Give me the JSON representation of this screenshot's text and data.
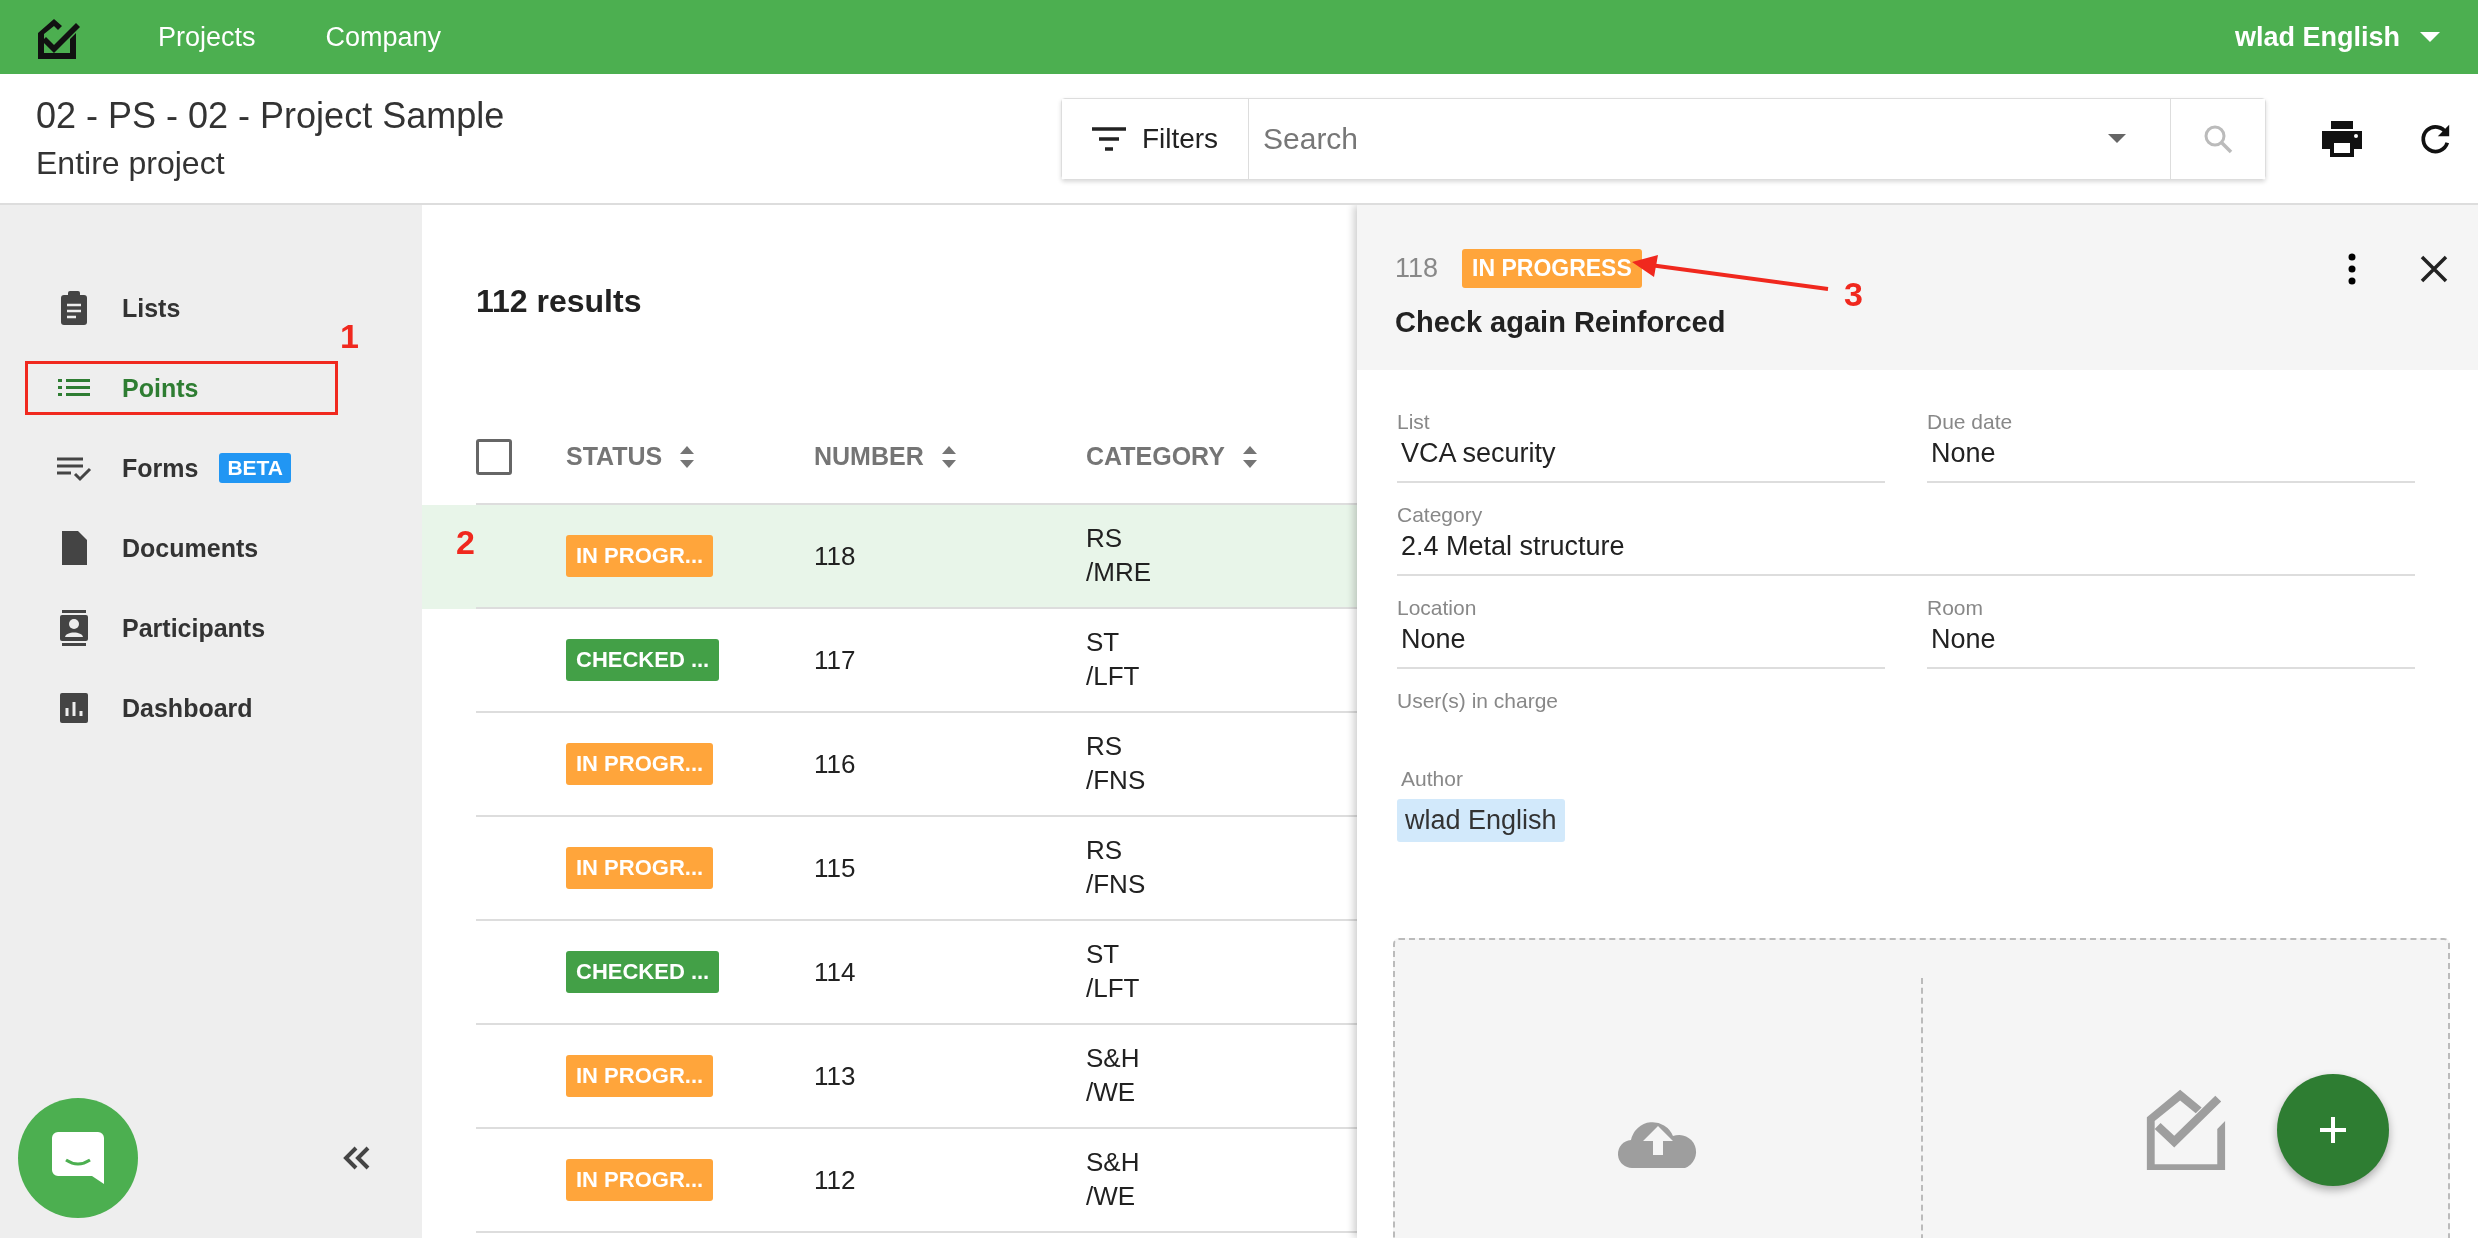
{
  "topbar": {
    "nav": [
      {
        "label": "Projects"
      },
      {
        "label": "Company"
      }
    ],
    "user": "wlad English"
  },
  "header": {
    "title": "02 - PS - 02 - Project Sample",
    "subtitle": "Entire project"
  },
  "search": {
    "filters_label": "Filters",
    "placeholder": "Search"
  },
  "sidebar": {
    "items": [
      {
        "label": "Lists",
        "selected": false,
        "highlighted": false
      },
      {
        "label": "Points",
        "selected": true,
        "highlighted": true
      },
      {
        "label": "Forms",
        "selected": false,
        "highlighted": false,
        "badge": "BETA"
      },
      {
        "label": "Documents",
        "selected": false,
        "highlighted": false
      },
      {
        "label": "Participants",
        "selected": false,
        "highlighted": false
      },
      {
        "label": "Dashboard",
        "selected": false,
        "highlighted": false
      }
    ]
  },
  "results": "112 results",
  "table": {
    "select_all": {
      "checked": false
    },
    "columns": [
      "STATUS",
      "NUMBER",
      "CATEGORY"
    ],
    "rows": [
      {
        "status": "IN PROGR...",
        "kind": "in_progress",
        "number": "118",
        "category": "RS\n/MRE",
        "selected": true
      },
      {
        "status": "CHECKED ...",
        "kind": "checked",
        "number": "117",
        "category": "ST\n/LFT",
        "selected": false
      },
      {
        "status": "IN PROGR...",
        "kind": "in_progress",
        "number": "116",
        "category": "RS\n/FNS",
        "selected": false
      },
      {
        "status": "IN PROGR...",
        "kind": "in_progress",
        "number": "115",
        "category": "RS\n/FNS",
        "selected": false
      },
      {
        "status": "CHECKED ...",
        "kind": "checked",
        "number": "114",
        "category": "ST\n/LFT",
        "selected": false
      },
      {
        "status": "IN PROGR...",
        "kind": "in_progress",
        "number": "113",
        "category": "S&H\n/WE",
        "selected": false
      },
      {
        "status": "IN PROGR...",
        "kind": "in_progress",
        "number": "112",
        "category": "S&H\n/WE",
        "selected": false
      }
    ]
  },
  "panel": {
    "number": "118",
    "status": {
      "label": "IN PROGRESS",
      "kind": "in_progress"
    },
    "title": "Check again Reinforced",
    "fields": [
      {
        "kind": "half",
        "label": "List",
        "value": "VCA security"
      },
      {
        "kind": "half",
        "label": "Due date",
        "value": "None"
      },
      {
        "kind": "wide",
        "label": "Category",
        "value": "2.4 Metal structure"
      },
      {
        "kind": "half",
        "label": "Location",
        "value": "None"
      },
      {
        "kind": "half",
        "label": "Room",
        "value": "None"
      },
      {
        "kind": "empty",
        "label": "User(s) in charge"
      }
    ],
    "author": {
      "label": "Author",
      "name": "wlad English"
    }
  },
  "annotations": [
    {
      "label": "1"
    },
    {
      "label": "2"
    },
    {
      "label": "3"
    }
  ]
}
